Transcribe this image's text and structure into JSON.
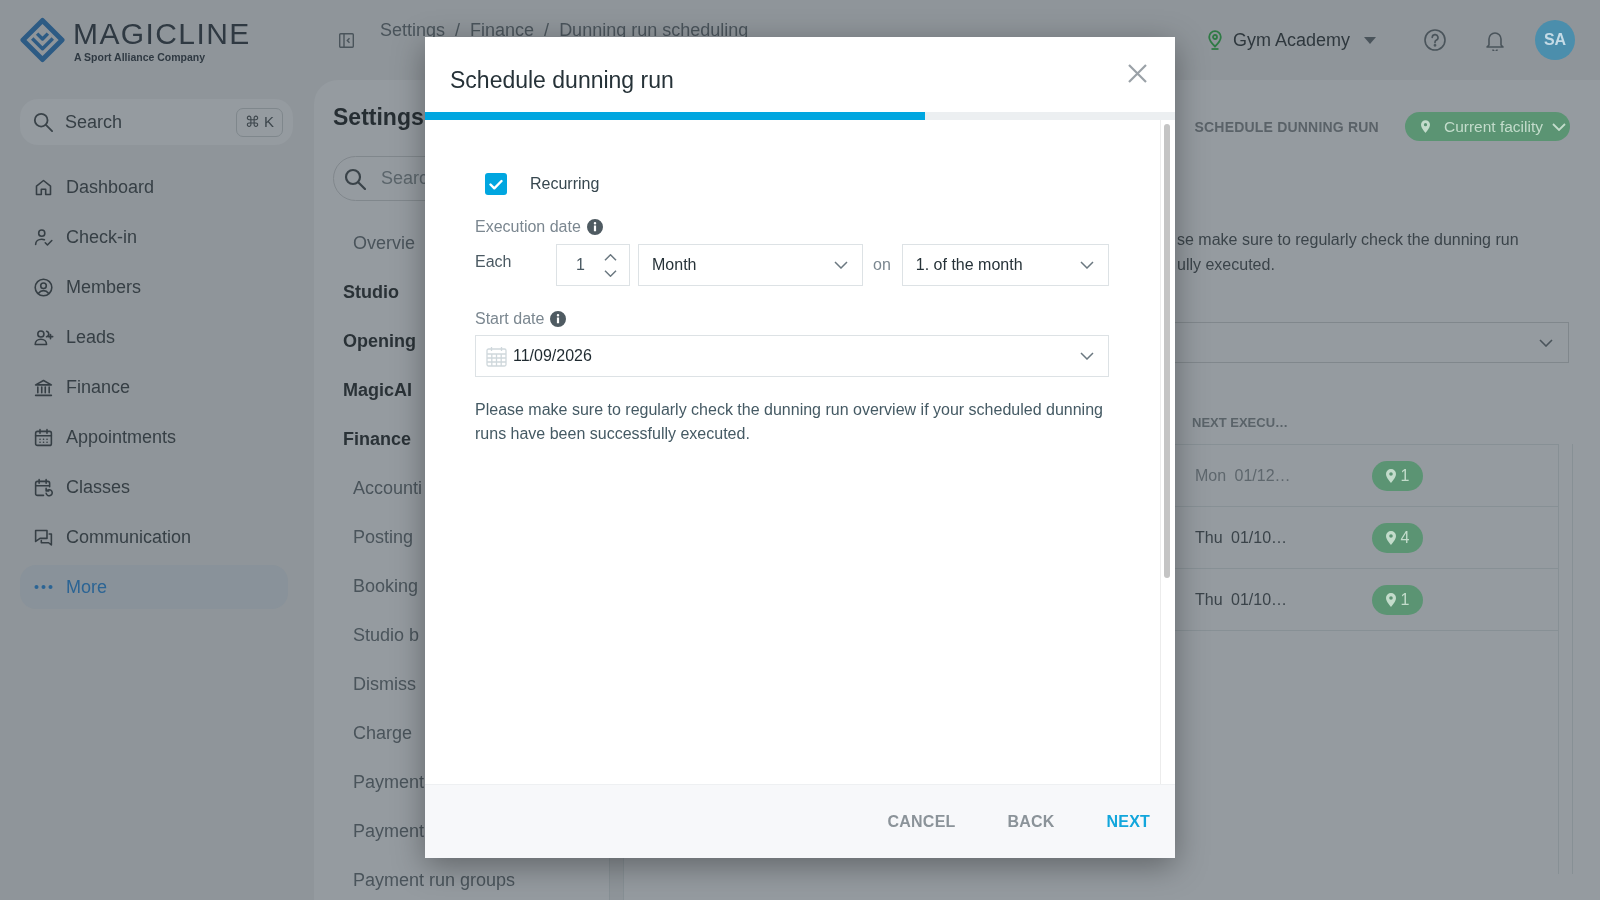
{
  "app_header": {
    "logo": {
      "wordmark": "MAGICLINE",
      "tagline": "A Sport Alliance Company"
    },
    "breadcrumb": {
      "items": [
        "Settings",
        "Finance",
        "Dunning run scheduling"
      ],
      "separator": "/"
    },
    "facility": "Gym Academy",
    "avatar": "SA"
  },
  "sidebar": {
    "search": {
      "label": "Search",
      "shortcut": "⌘ K"
    },
    "items": [
      {
        "label": "Dashboard",
        "selected": false
      },
      {
        "label": "Check-in",
        "selected": false
      },
      {
        "label": "Members",
        "selected": false
      },
      {
        "label": "Leads",
        "selected": false
      },
      {
        "label": "Finance",
        "selected": false
      },
      {
        "label": "Appointments",
        "selected": false
      },
      {
        "label": "Classes",
        "selected": false
      },
      {
        "label": "Communication",
        "selected": false
      },
      {
        "label": "More",
        "selected": true
      }
    ]
  },
  "settings_panel": {
    "title": "Settings",
    "search": {
      "placeholder": "Searc"
    },
    "items": [
      {
        "kind": "link",
        "label": "Overvie"
      },
      {
        "kind": "group",
        "label": "Studio"
      },
      {
        "kind": "group",
        "label": "Opening"
      },
      {
        "kind": "group",
        "label": "MagicAI"
      },
      {
        "kind": "group",
        "label": "Finance",
        "children": [
          {
            "kind": "link",
            "label": "Accounti"
          },
          {
            "kind": "link",
            "label": "Posting"
          },
          {
            "kind": "link",
            "label": "Booking"
          },
          {
            "kind": "link",
            "label": "Studio b"
          },
          {
            "kind": "link",
            "label": "Dismiss"
          },
          {
            "kind": "link",
            "label": "Charge"
          },
          {
            "kind": "link",
            "label": "Payment"
          },
          {
            "kind": "link",
            "label": "Payment"
          },
          {
            "kind": "link",
            "label": "Payment run groups"
          }
        ]
      }
    ]
  },
  "main": {
    "actions": [
      {
        "kind": "text",
        "label": "SCHEDULE DUNNING RUN"
      },
      {
        "kind": "filter",
        "label": "Current facility"
      }
    ],
    "notice": [
      "se make sure to regularly check the dunning run",
      "ully executed."
    ],
    "table": {
      "columns": [
        "NEXT EXECU…"
      ],
      "rows": [
        {
          "date": "Mon 01/12…",
          "pin_badge": "1",
          "disabled": true
        },
        {
          "date": "Thu 01/10…",
          "pin_badge": "4",
          "disabled": false
        },
        {
          "date": "Thu 01/10…",
          "pin_badge": "1",
          "disabled": false
        }
      ]
    }
  },
  "modal": {
    "title": "Schedule dunning run",
    "progress": {
      "level": 0.667
    },
    "recurring": {
      "label": "Recurring",
      "checked": true
    },
    "execution_date": {
      "label": "Execution date",
      "each_label": "Each",
      "interval": "1",
      "unit": "Month",
      "on_label": "on",
      "day": "1. of the month"
    },
    "start_date": {
      "label": "Start date",
      "value": "11/09/2026"
    },
    "note": "Please make sure to regularly check the dunning run overview if your scheduled dunning runs have been successfully executed.",
    "buttons": [
      {
        "kind": "secondary",
        "label": "CANCEL"
      },
      {
        "kind": "secondary",
        "label": "BACK"
      },
      {
        "kind": "primary",
        "label": "NEXT"
      }
    ]
  }
}
